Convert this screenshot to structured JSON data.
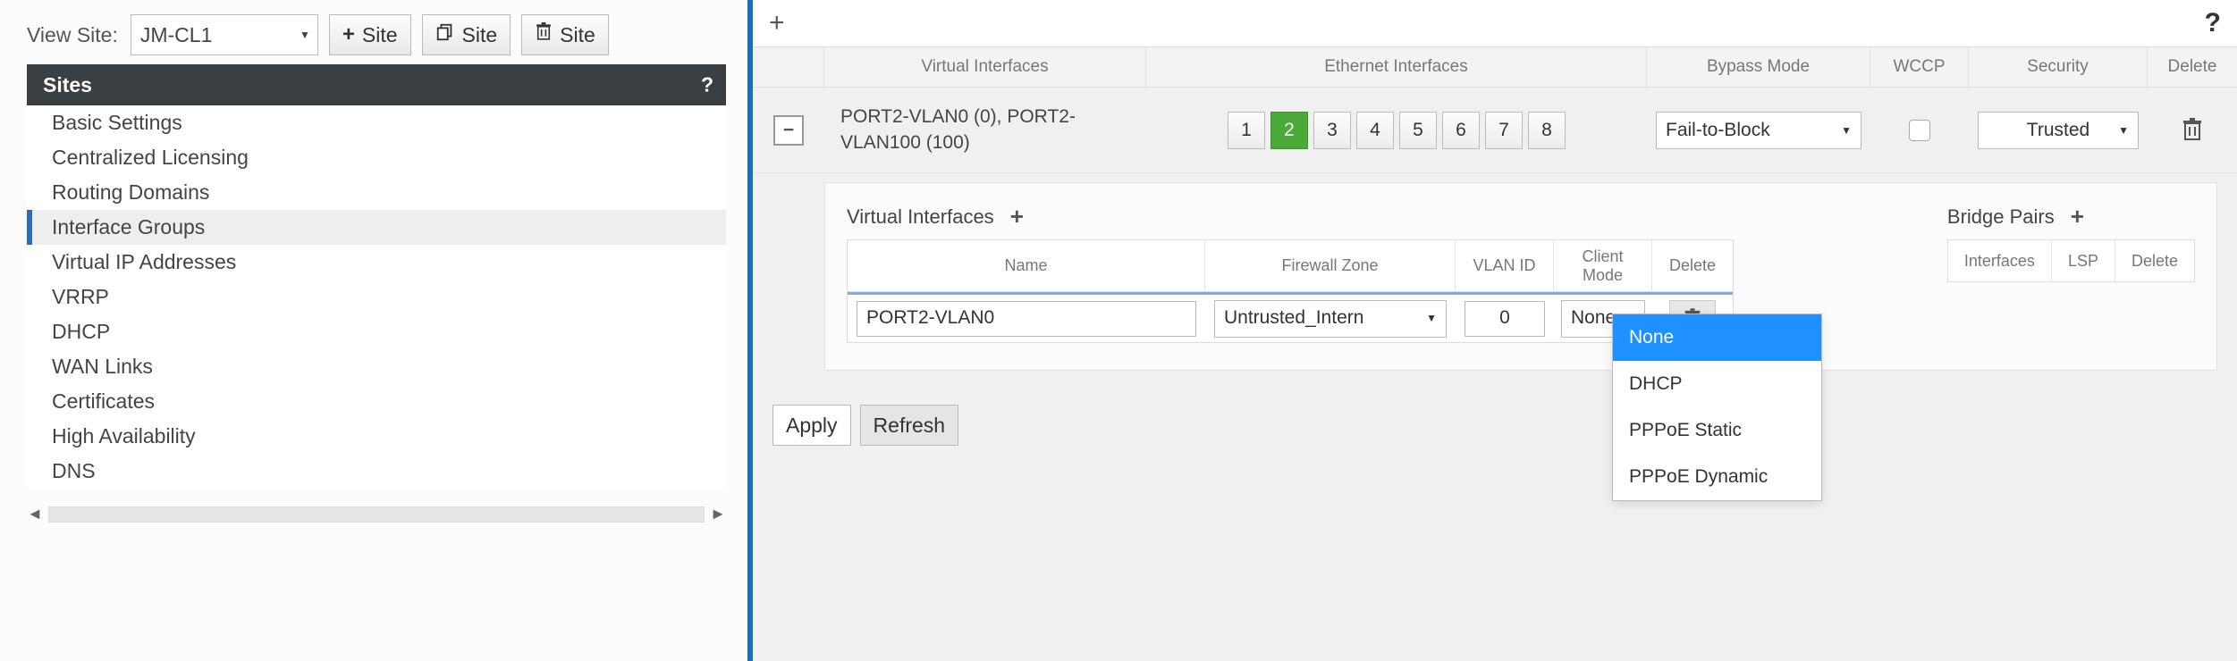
{
  "left": {
    "view_site_label": "View Site:",
    "selected_site": "JM-CL1",
    "buttons": {
      "add_site": "Site",
      "clone_site": "Site",
      "delete_site": "Site"
    },
    "sites_header": "Sites",
    "help": "?",
    "nav_items": [
      "Basic Settings",
      "Centralized Licensing",
      "Routing Domains",
      "Interface Groups",
      "Virtual IP Addresses",
      "VRRP",
      "DHCP",
      "WAN Links",
      "Certificates",
      "High Availability",
      "DNS"
    ],
    "selected_nav_index": 3
  },
  "main": {
    "help": "?",
    "columns": {
      "virtual_interfaces": "Virtual Interfaces",
      "ethernet_interfaces": "Ethernet Interfaces",
      "bypass_mode": "Bypass Mode",
      "wccp": "WCCP",
      "security": "Security",
      "delete": "Delete"
    },
    "row": {
      "expanded": true,
      "vi_text": "PORT2-VLAN0 (0), PORT2-VLAN100 (100)",
      "eth_buttons": [
        "1",
        "2",
        "3",
        "4",
        "5",
        "6",
        "7",
        "8"
      ],
      "eth_active_index": 1,
      "bypass_mode": "Fail-to-Block",
      "wccp_checked": false,
      "security": "Trusted"
    },
    "detail": {
      "vi_section_title": "Virtual Interfaces",
      "vi_headers": {
        "name": "Name",
        "zone": "Firewall Zone",
        "vlan": "VLAN ID",
        "cmode": "Client Mode",
        "delete": "Delete"
      },
      "vi_row": {
        "name": "PORT2-VLAN0",
        "zone": "Untrusted_Intern",
        "vlan": "0",
        "cmode": "None"
      },
      "cmode_options": [
        "None",
        "DHCP",
        "PPPoE Static",
        "PPPoE Dynamic"
      ],
      "cmode_selected_index": 0,
      "bridge_section_title": "Bridge Pairs",
      "bridge_headers": {
        "ifaces": "Interfaces",
        "lsp": "LSP",
        "delete": "Delete"
      }
    },
    "footer": {
      "apply": "Apply",
      "refresh": "Refresh"
    }
  }
}
